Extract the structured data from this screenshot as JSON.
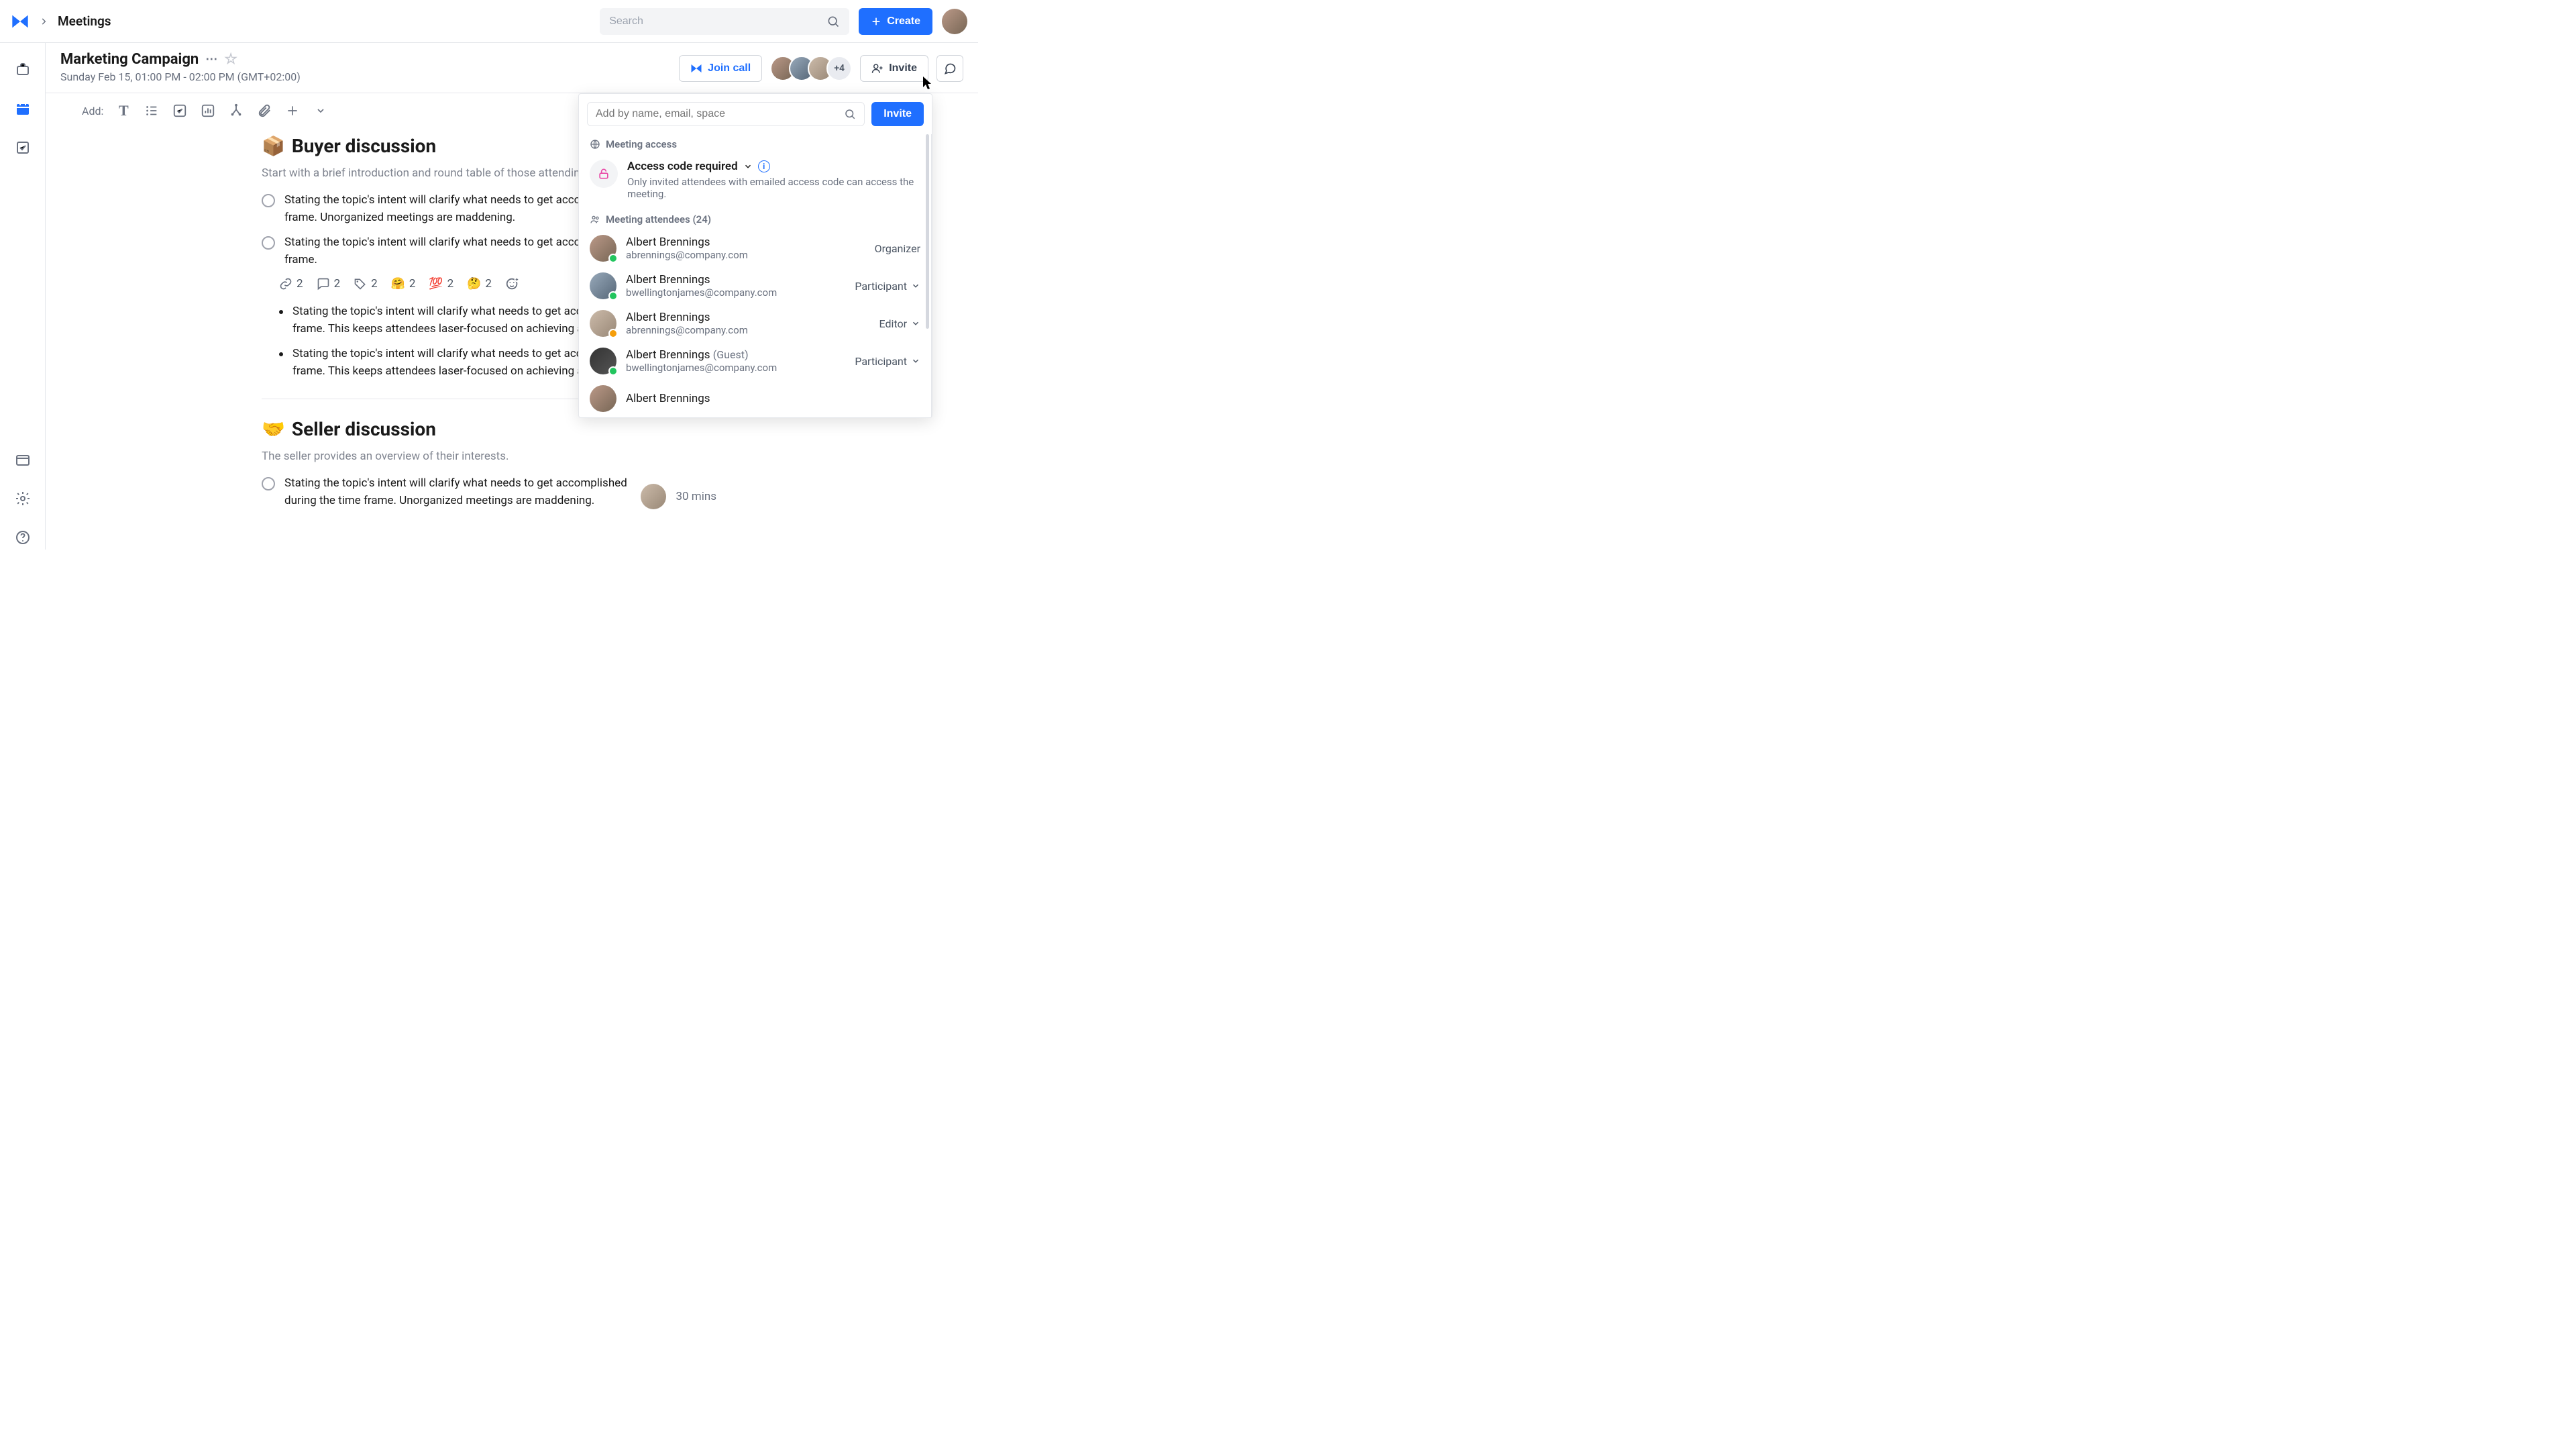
{
  "header": {
    "breadcrumb": "Meetings",
    "searchPlaceholder": "Search",
    "createLabel": "Create"
  },
  "page": {
    "title": "Marketing Campaign",
    "subtitle": "Sunday Feb 15, 01:00 PM - 02:00 PM (GMT+02:00)",
    "joinCall": "Join call",
    "inviteLabel": "Invite",
    "avatarOverflow": "+4"
  },
  "addRow": {
    "label": "Add:"
  },
  "sections": [
    {
      "emoji": "📦",
      "title": "Buyer discussion",
      "intro": "Start with a brief introduction and round table of those attending the meeting.",
      "tasks": [
        "Stating the topic's intent will clarify what needs to get accomplished during the time frame. Unorganized meetings are maddening.",
        "Stating the topic's intent will clarify what needs to get accomplished during the time frame."
      ],
      "bullets": [
        "Stating the topic's intent will clarify what needs to get accomplished during the time frame. This keeps attendees laser-focused on achieving a goal.",
        "Stating the topic's intent will clarify what needs to get accomplished during the time frame. This keeps attendees laser-focused on achieving a goal."
      ]
    },
    {
      "emoji": "🤝",
      "title": "Seller discussion",
      "intro": "The seller provides an overview of their interests.",
      "tasks": [
        "Stating the topic's intent will clarify what needs to get accomplished during the time frame. Unorganized meetings are maddening."
      ],
      "assignTime": "30 mins"
    }
  ],
  "reactions": [
    {
      "icon": "link",
      "count": "2"
    },
    {
      "icon": "comment",
      "count": "2"
    },
    {
      "icon": "tag",
      "count": "2"
    },
    {
      "icon": "emoji",
      "glyph": "🤗",
      "count": "2"
    },
    {
      "icon": "emoji",
      "glyph": "💯",
      "count": "2"
    },
    {
      "icon": "emoji",
      "glyph": "🤔",
      "count": "2"
    }
  ],
  "panel": {
    "addPlaceholder": "Add by name, email, space",
    "inviteBtn": "Invite",
    "accessLabel": "Meeting access",
    "accessMode": "Access code required",
    "accessDesc": "Only invited attendees with emailed access code can access the meeting.",
    "attendeesLabel": "Meeting attendees (24)",
    "attendees": [
      {
        "name": "Albert Brennings",
        "email": "abrennings@company.com",
        "role": "Organizer",
        "status": "green",
        "hasDropdown": false
      },
      {
        "name": "Albert Brennings",
        "email": "bwellingtonjames@company.com",
        "role": "Participant",
        "status": "green",
        "hasDropdown": true
      },
      {
        "name": "Albert Brennings",
        "email": "abrennings@company.com",
        "role": "Editor",
        "status": "yellow",
        "hasDropdown": true
      },
      {
        "name": "Albert Brennings",
        "guest": "(Guest)",
        "email": "bwellingtonjames@company.com",
        "role": "Participant",
        "status": "green",
        "hasDropdown": true
      },
      {
        "name": "Albert Brennings",
        "email": "",
        "role": "",
        "status": "",
        "hasDropdown": false
      }
    ]
  }
}
